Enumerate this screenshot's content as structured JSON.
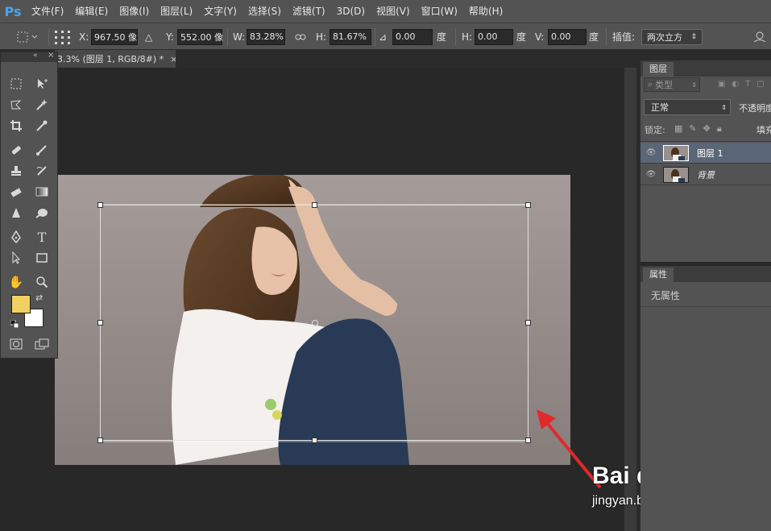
{
  "app": {
    "logo": "Ps"
  },
  "menu": [
    "文件(F)",
    "编辑(E)",
    "图像(I)",
    "图层(L)",
    "文字(Y)",
    "选择(S)",
    "滤镜(T)",
    "3D(D)",
    "视图(V)",
    "窗口(W)",
    "帮助(H)"
  ],
  "options": {
    "x_label": "X:",
    "x_value": "967.50 像",
    "y_label": "Y:",
    "y_value": "552.00 像",
    "w_label": "W:",
    "w_value": "83.28%",
    "h_label": "H:",
    "h_value": "81.67%",
    "angle_value": "0.00",
    "angle_unit": "度",
    "hskew_label": "H:",
    "hskew_value": "0.00",
    "hskew_unit": "度",
    "vskew_label": "V:",
    "vskew_value": "0.00",
    "vskew_unit": "度",
    "interp_label": "插值:",
    "interp_value": "两次立方"
  },
  "document": {
    "tab_title": "3.3% (图层 1, RGB/8#) *",
    "close": "×"
  },
  "layers_panel": {
    "tab": "图层",
    "filter_label": "类型",
    "blend_mode": "正常",
    "opacity_label": "不透明度",
    "lock_label": "锁定:",
    "fill_label": "填充",
    "layers": [
      {
        "name": "图层 1",
        "selected": true
      },
      {
        "name": "背景",
        "selected": false
      }
    ]
  },
  "properties_panel": {
    "tab": "属性",
    "empty_text": "无属性"
  },
  "colors": {
    "foreground": "#f0d060",
    "background": "#ffffff",
    "selected_layer": "#5b6677",
    "accent": "#4aa3f0"
  },
  "icons": [
    "move-icon",
    "marquee-icon",
    "lasso-icon",
    "magic-wand-icon",
    "crop-icon",
    "eyedropper-icon",
    "healing-icon",
    "brush-icon",
    "stamp-icon",
    "history-brush-icon",
    "eraser-icon",
    "gradient-icon",
    "blur-icon",
    "dodge-icon",
    "pen-icon",
    "type-icon",
    "path-select-icon",
    "shape-icon",
    "hand-icon",
    "zoom-icon"
  ],
  "watermark": {
    "brand": "Bai du 经验",
    "url": "jingyan.baidu.com"
  }
}
